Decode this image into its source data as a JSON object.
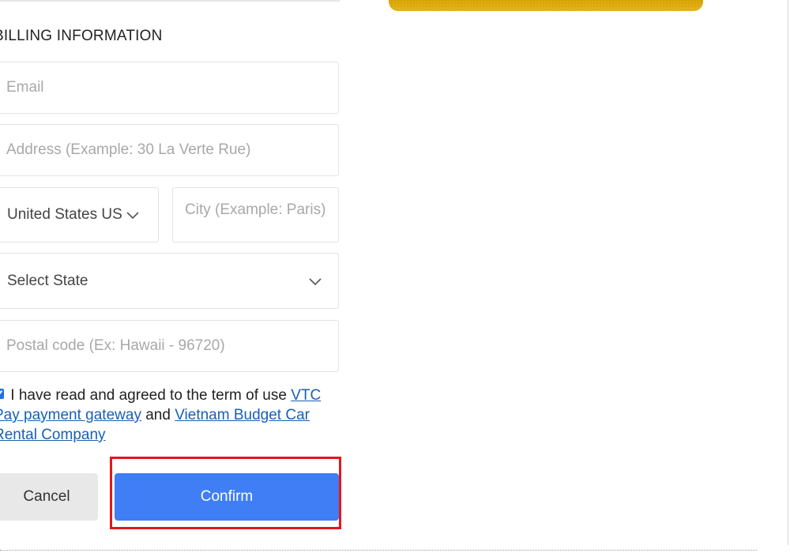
{
  "billing": {
    "title": "BILLING INFORMATION",
    "email_placeholder": "Email",
    "address_placeholder": "Address (Example: 30 La Verte Rue)",
    "country_value": "United States US",
    "city_placeholder": "City (Example: Paris)",
    "state_value": "Select State",
    "postal_placeholder": "Postal code (Ex: Hawaii - 96720)"
  },
  "agreement": {
    "checked": true,
    "text": "I have read and agreed to the term of use",
    "link1": "VTC Pay payment gateway",
    "joiner": "and",
    "link2": "Vietnam Budget Car Rental Company"
  },
  "actions": {
    "cancel_label": "Cancel",
    "confirm_label": "Confirm"
  },
  "colors": {
    "confirm_bg": "#3f7ef4",
    "cancel_bg": "#e8e8e8",
    "link": "#1a5fb4",
    "highlight": "#e4161f",
    "card_gold": "#d4a200"
  },
  "icons": {
    "country_dropdown": "chevron-down-icon",
    "state_dropdown": "chevron-down-icon"
  }
}
